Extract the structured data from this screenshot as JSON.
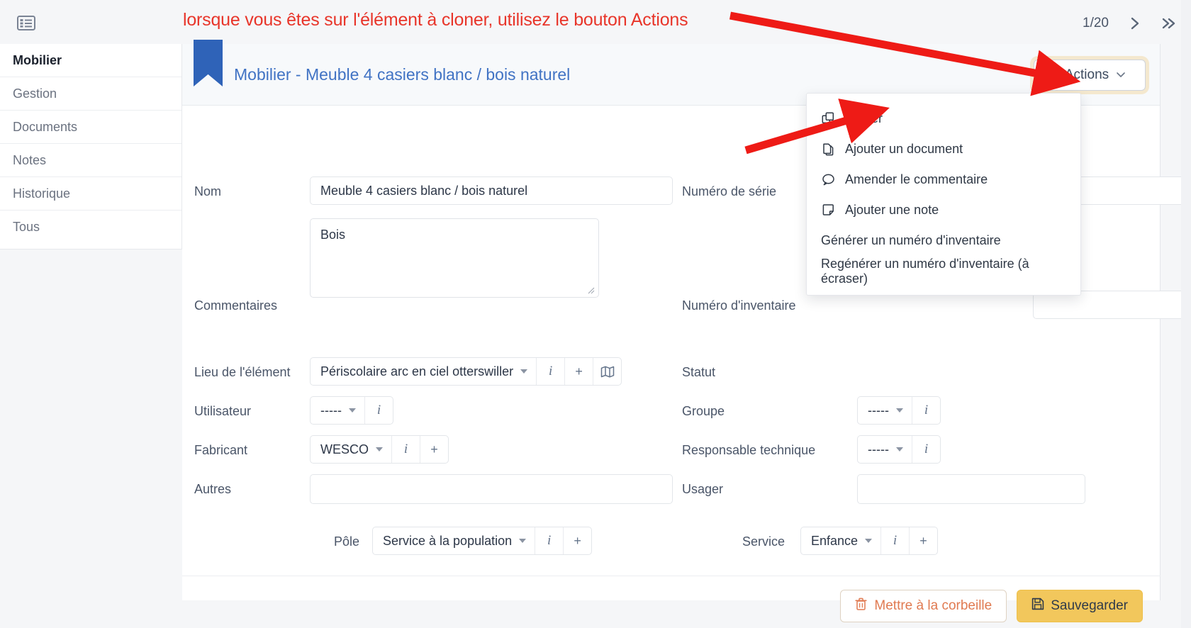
{
  "topbar": {
    "list_icon": "list-panel-icon",
    "annotation": "lorsque vous êtes sur l'élément à cloner, utilisez le bouton Actions",
    "annotation_color": "#e8352a",
    "pager_count": "1/20",
    "next_icon": "chevron-right-icon",
    "last_icon": "chevron-double-right-icon"
  },
  "sidebar": {
    "items": [
      {
        "label": "Mobilier",
        "active": true
      },
      {
        "label": "Gestion",
        "active": false
      },
      {
        "label": "Documents",
        "active": false
      },
      {
        "label": "Notes",
        "active": false
      },
      {
        "label": "Historique",
        "active": false
      },
      {
        "label": "Tous",
        "active": false
      }
    ]
  },
  "header": {
    "bookmark_icon": "bookmark-icon",
    "bookmark_color": "#2f63b8",
    "title": "Mobilier - Meuble 4 casiers blanc / bois naturel",
    "title_color": "#4173c4",
    "actions_label": "Actions",
    "actions_menu_icon": "vertical-dots-icon",
    "actions_caret_icon": "chevron-down-icon",
    "actions_highlight": "#f0d296"
  },
  "form": {
    "nom": {
      "label": "Nom",
      "value": "Meuble 4 casiers blanc / bois naturel"
    },
    "commentaires": {
      "label": "Commentaires",
      "value": "Bois"
    },
    "lieu": {
      "label": "Lieu de l'élément",
      "value": "Périscolaire arc en ciel otterswiller",
      "info_label": "i",
      "add_label": "+",
      "map_icon": "map-icon"
    },
    "utilisateur": {
      "label": "Utilisateur",
      "value": "-----",
      "info_label": "i"
    },
    "fabricant": {
      "label": "Fabricant",
      "value": "WESCO",
      "info_label": "i",
      "add_label": "+"
    },
    "autres": {
      "label": "Autres",
      "value": ""
    },
    "numero_serie": {
      "label": "Numéro de série",
      "value": ""
    },
    "numero_inventaire": {
      "label": "Numéro d'inventaire",
      "value": ""
    },
    "statut": {
      "label": "Statut",
      "value": ""
    },
    "groupe": {
      "label": "Groupe",
      "value": "-----",
      "info_label": "i"
    },
    "responsable": {
      "label": "Responsable technique",
      "value": "-----",
      "info_label": "i"
    },
    "usager": {
      "label": "Usager",
      "value": ""
    },
    "pole": {
      "label": "Pôle",
      "value": "Service à la population",
      "info_label": "i",
      "add_label": "+"
    },
    "service": {
      "label": "Service",
      "value": "Enfance",
      "info_label": "i",
      "add_label": "+"
    }
  },
  "footer": {
    "trash_label": "Mettre à la corbeille",
    "trash_icon": "trash-icon",
    "trash_color": "#e07a51",
    "save_label": "Sauvegarder",
    "save_icon": "floppy-save-icon",
    "save_color": "#f2c75c"
  },
  "dropdown": {
    "items": [
      {
        "label": "Clôner",
        "icon": "clone-icon"
      },
      {
        "label": "Ajouter un document",
        "icon": "document-copy-icon"
      },
      {
        "label": "Amender le commentaire",
        "icon": "comment-bubble-icon"
      },
      {
        "label": "Ajouter une note",
        "icon": "note-icon"
      },
      {
        "label": "Générer un numéro d'inventaire",
        "icon": ""
      },
      {
        "label": "Regénérer un numéro d'inventaire (à écraser)",
        "icon": ""
      }
    ]
  }
}
